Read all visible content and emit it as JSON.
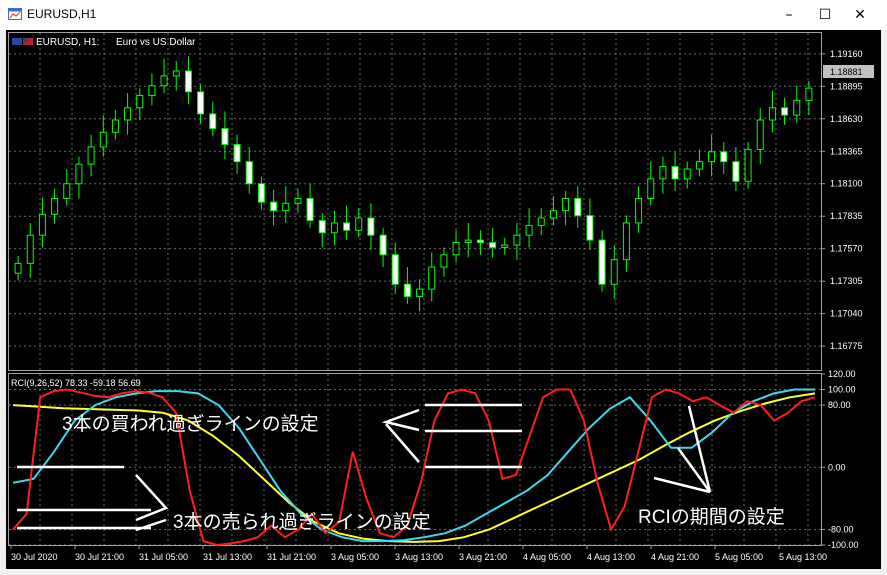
{
  "window": {
    "title": "EURUSD,H1",
    "minimize_glyph": "–",
    "maximize_glyph": "☐",
    "close_glyph": "✕"
  },
  "price_panel": {
    "symbol_label": "EURUSD, H1:",
    "description": "Euro vs US Dollar",
    "current_price": "1.18881",
    "price_ticks": [
      "1.19160",
      "1.18895",
      "1.18630",
      "1.18365",
      "1.18100",
      "1.17835",
      "1.17570",
      "1.17305",
      "1.17040",
      "1.16775"
    ]
  },
  "indicator_panel": {
    "label": "RCI(9,26,52) 78.33 -59.18 56.69",
    "level_ticks": [
      "120.00",
      "100.00",
      "80.00",
      "0.00",
      "-80.00",
      "-100.00"
    ]
  },
  "time_axis": {
    "labels": [
      "30 Jul 2020",
      "30 Jul 21:00",
      "31 Jul 05:00",
      "31 Jul 13:00",
      "31 Jul 21:00",
      "3 Aug 05:00",
      "3 Aug 13:00",
      "3 Aug 21:00",
      "4 Aug 05:00",
      "4 Aug 13:00",
      "4 Aug 21:00",
      "5 Aug 05:00",
      "5 Aug 13:00"
    ]
  },
  "annotations": {
    "overbought": "3本の買われ過ぎラインの設定",
    "oversold": "3本の売られ過ぎラインの設定",
    "period": "RCIの期間の設定"
  },
  "colors": {
    "chart_background": "#000000",
    "grid": "#607060",
    "candle": "#00ff00",
    "rci_short": "#ff1e1e",
    "rci_medium": "#3fd8f0",
    "rci_long": "#ffff2a",
    "annotation_text": "#ffffff"
  },
  "chart_data": [
    {
      "type": "candlestick",
      "title": "EURUSD, H1: Euro vs US Dollar",
      "y_ticks": [
        1.16775,
        1.1704,
        1.17305,
        1.1757,
        1.17835,
        1.181,
        1.18365,
        1.1863,
        1.18895,
        1.1916
      ],
      "ylim": [
        1.1658,
        1.1933
      ],
      "current_price": 1.18881,
      "close": [
        1.1745,
        1.1768,
        1.1785,
        1.1798,
        1.181,
        1.1826,
        1.184,
        1.1852,
        1.1862,
        1.1872,
        1.1882,
        1.189,
        1.1898,
        1.1902,
        1.1885,
        1.1867,
        1.1855,
        1.1842,
        1.1828,
        1.181,
        1.1795,
        1.1788,
        1.1794,
        1.1798,
        1.178,
        1.177,
        1.1778,
        1.1772,
        1.1782,
        1.1768,
        1.1752,
        1.1728,
        1.1718,
        1.1724,
        1.1742,
        1.1752,
        1.1762,
        1.1764,
        1.1762,
        1.1758,
        1.176,
        1.1768,
        1.1776,
        1.1782,
        1.1788,
        1.1798,
        1.1784,
        1.1764,
        1.1728,
        1.1748,
        1.1778,
        1.1798,
        1.1814,
        1.1824,
        1.1814,
        1.1822,
        1.1828,
        1.1836,
        1.1828,
        1.1812,
        1.1838,
        1.1862,
        1.1872,
        1.1866,
        1.1878,
        1.1888
      ]
    },
    {
      "type": "line",
      "title": "RCI(9,26,52)",
      "ylim": [
        -100,
        120
      ],
      "levels": [
        100,
        80,
        0,
        -80,
        -100
      ],
      "series": [
        {
          "values": [
            -80,
            -60,
            90,
            98,
            100,
            96,
            92,
            90,
            95,
            98,
            96,
            90,
            70,
            -30,
            -95,
            -100,
            -98,
            -95,
            -90,
            -75,
            -90,
            -80,
            -60,
            -85,
            -70,
            20,
            -40,
            -85,
            -90,
            -75,
            -20,
            60,
            95,
            100,
            95,
            60,
            -15,
            -10,
            40,
            90,
            100,
            100,
            60,
            -20,
            -80,
            -50,
            20,
            90,
            100,
            95,
            85,
            90,
            80,
            70,
            85,
            80,
            60,
            70,
            85,
            90
          ]
        },
        {
          "values": [
            -20,
            -15,
            20,
            60,
            80,
            90,
            95,
            98,
            98,
            95,
            80,
            50,
            10,
            -30,
            -60,
            -80,
            -90,
            -95,
            -95,
            -94,
            -90,
            -85,
            -75,
            -60,
            -45,
            -30,
            -10,
            20,
            50,
            75,
            90,
            60,
            25,
            25,
            45,
            70,
            85,
            95,
            100,
            100
          ]
        },
        {
          "values": [
            80,
            78,
            76,
            75,
            74,
            73,
            70,
            60,
            40,
            15,
            -15,
            -45,
            -70,
            -85,
            -92,
            -95,
            -96,
            -95,
            -90,
            -80,
            -65,
            -50,
            -35,
            -20,
            -5,
            10,
            28,
            45,
            60,
            72,
            82,
            90,
            95
          ]
        }
      ]
    }
  ]
}
